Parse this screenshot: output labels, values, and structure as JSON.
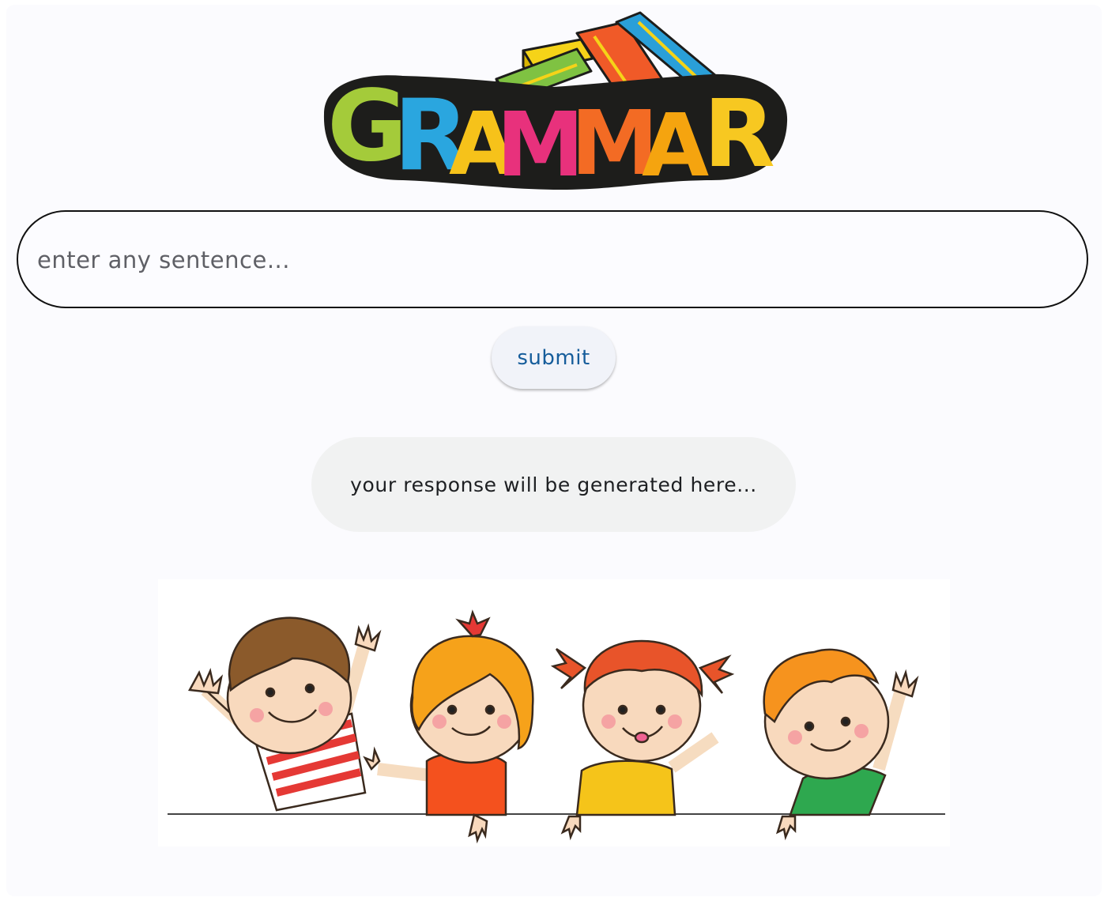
{
  "logo": {
    "text": "GRAMMAR",
    "letters": [
      "G",
      "R",
      "A",
      "M",
      "M",
      "A",
      "R"
    ],
    "letter_colors": [
      "#a4cb3a",
      "#2aa6df",
      "#f6c21a",
      "#e8317c",
      "#f36b24",
      "#f5a40f",
      "#f7c821"
    ],
    "outline_color": "#1d1d1b",
    "book_colors": [
      "#f5d318",
      "#7fc242",
      "#f05a28",
      "#2a9fd8"
    ]
  },
  "search": {
    "placeholder": "enter any sentence...",
    "value": ""
  },
  "submit": {
    "label": "submit"
  },
  "response": {
    "text": "your response will be generated here..."
  },
  "illustration": {
    "icon": "waving-kids-illustration"
  },
  "colors": {
    "accent_text": "#165d9b",
    "input_border": "#111111",
    "response_bg": "#f1f2f2"
  }
}
